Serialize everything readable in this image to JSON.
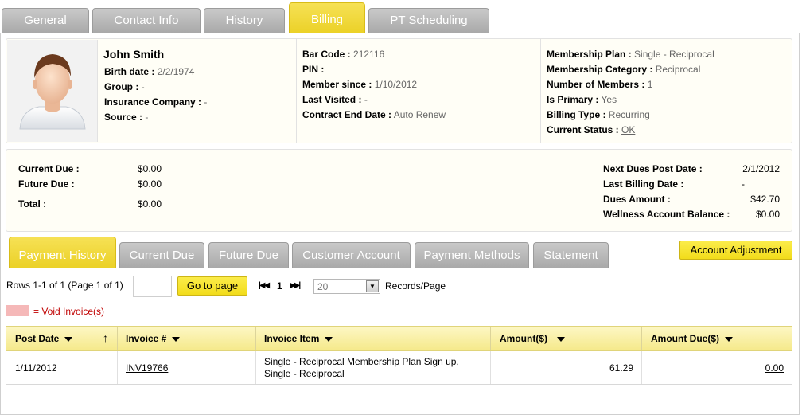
{
  "top_tabs": [
    {
      "label": "General"
    },
    {
      "label": "Contact Info"
    },
    {
      "label": "History"
    },
    {
      "label": "Billing"
    },
    {
      "label": "PT Scheduling"
    }
  ],
  "profile": {
    "name": "John Smith",
    "birth_date_label": "Birth date :",
    "birth_date": "2/2/1974",
    "group_label": "Group :",
    "group": "-",
    "insurance_label": "Insurance Company :",
    "insurance": "-",
    "source_label": "Source :",
    "source": "-"
  },
  "account": {
    "bar_code_label": "Bar Code :",
    "bar_code": "212116",
    "pin_label": "PIN :",
    "pin": "",
    "member_since_label": "Member since :",
    "member_since": "1/10/2012",
    "last_visited_label": "Last Visited :",
    "last_visited": "-",
    "contract_end_label": "Contract End Date :",
    "contract_end": "Auto Renew"
  },
  "membership": {
    "plan_label": "Membership Plan :",
    "plan": "Single - Reciprocal",
    "category_label": "Membership Category :",
    "category": "Reciprocal",
    "members_label": "Number of Members :",
    "members": "1",
    "primary_label": "Is Primary :",
    "primary": "Yes",
    "billing_type_label": "Billing Type :",
    "billing_type": "Recurring",
    "status_label": "Current Status :",
    "status": "OK"
  },
  "dues": {
    "current_due_label": "Current Due :",
    "current_due": "$0.00",
    "future_due_label": "Future Due :",
    "future_due": "$0.00",
    "total_label": "Total :",
    "total": "$0.00",
    "next_post_label": "Next Dues Post Date :",
    "next_post": "2/1/2012",
    "last_billing_label": "Last Billing Date :",
    "last_billing": "-",
    "dues_amount_label": "Dues Amount :",
    "dues_amount": "$42.70",
    "wellness_label": "Wellness Account Balance :",
    "wellness": "$0.00"
  },
  "sub_tabs": [
    {
      "label": "Payment History"
    },
    {
      "label": "Current Due"
    },
    {
      "label": "Future Due"
    },
    {
      "label": "Customer Account"
    },
    {
      "label": "Payment Methods"
    },
    {
      "label": "Statement"
    }
  ],
  "account_adjustment_label": "Account Adjustment",
  "pager": {
    "rows_text": "Rows 1-1 of 1 (Page 1 of 1)",
    "page_input": "",
    "go_label": "Go to page",
    "first_icon": "first-page-icon",
    "current_page": "1",
    "last_icon": "last-page-icon",
    "page_size": "20",
    "records_label": "Records/Page"
  },
  "legend": {
    "void_text": "= Void Invoice(s)",
    "void_color": "#f5b8b8"
  },
  "grid": {
    "columns": [
      "Post Date",
      "Invoice #",
      "Invoice Item",
      "Amount($)",
      "Amount Due($)"
    ],
    "rows": [
      {
        "post_date": "1/11/2012",
        "invoice": "INV19766",
        "item_line1": "Single - Reciprocal Membership Plan Sign up,",
        "item_line2": "Single - Reciprocal",
        "amount": "61.29",
        "amount_due": "0.00"
      }
    ]
  },
  "colors": {
    "accent_yellow": "#f2dc1b",
    "tab_gray": "#b5b5b5",
    "void_red": "#c00000"
  }
}
